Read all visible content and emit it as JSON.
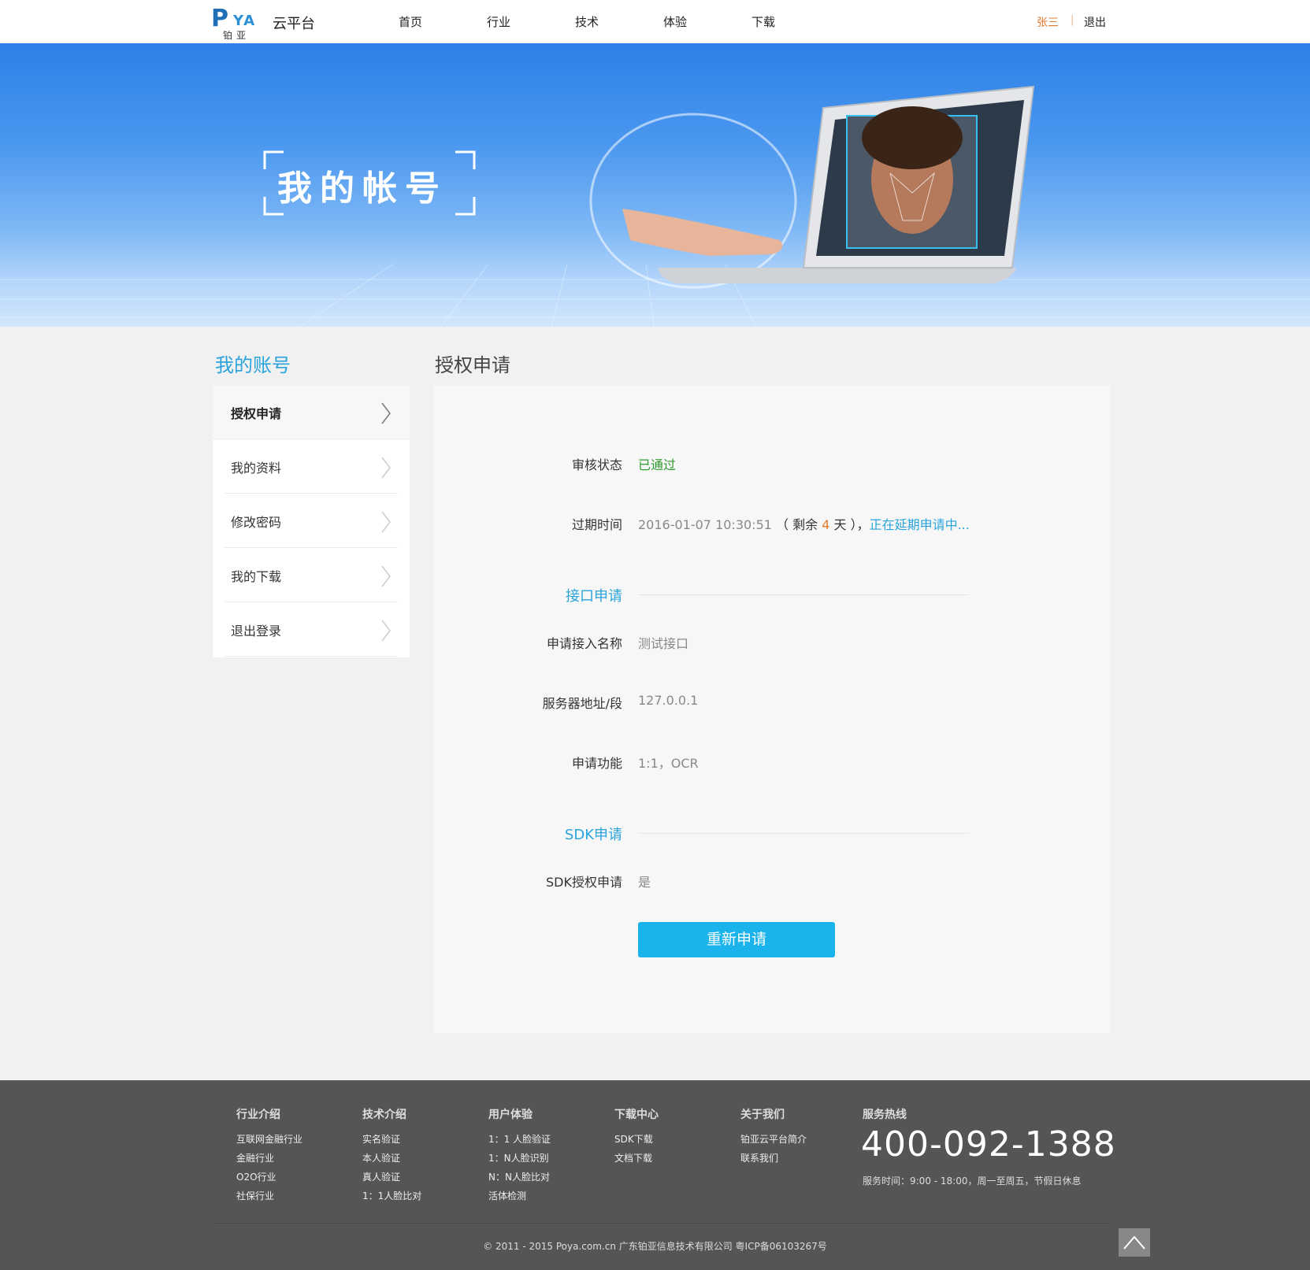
{
  "header": {
    "logo_letter": "P",
    "logo_ya": "YA",
    "logo_cn": "铂亚",
    "brand": "云平台",
    "nav": [
      "首页",
      "行业",
      "技术",
      "体验",
      "下载"
    ],
    "user": "张三",
    "separator": "|",
    "logout": "退出"
  },
  "banner": {
    "title": "我的帐号"
  },
  "sidebar": {
    "title": "我的账号",
    "items": [
      {
        "label": "授权申请",
        "active": true
      },
      {
        "label": "我的资料"
      },
      {
        "label": "修改密码"
      },
      {
        "label": "我的下载"
      },
      {
        "label": "退出登录"
      }
    ]
  },
  "main": {
    "title": "授权申请",
    "status_label": "审核状态",
    "status_value": "已通过",
    "expire_label": "过期时间",
    "expire_date": "2016-01-07 10:30:51",
    "remain_prefix": "（ 剩余",
    "remain_days": "4",
    "remain_suffix": "天 ），",
    "extend_link": "正在延期申请中...",
    "api_section": "接口申请",
    "api_name_label": "申请接入名称",
    "api_name_value": "测试接口",
    "server_label": "服务器地址/段",
    "server_value": "127.0.0.1",
    "func_label": "申请功能",
    "func_value": "1:1，OCR",
    "sdk_section": "SDK申请",
    "sdk_label": "SDK授权申请",
    "sdk_value": "是",
    "reapply_button": "重新申请"
  },
  "footer": {
    "columns": [
      {
        "title": "行业介绍",
        "items": [
          "互联网金融行业",
          "金融行业",
          "O2O行业",
          "社保行业"
        ]
      },
      {
        "title": "技术介绍",
        "items": [
          "实名验证",
          "本人验证",
          "真人验证",
          "1：1人脸比对"
        ]
      },
      {
        "title": "用户体验",
        "items": [
          "1：1 人脸验证",
          "1：N人脸识别",
          "N：N人脸比对",
          "活体检测"
        ]
      },
      {
        "title": "下载中心",
        "items": [
          "SDK下载",
          "文档下载"
        ]
      },
      {
        "title": "关于我们",
        "items": [
          "铂亚云平台简介",
          "联系我们"
        ]
      }
    ],
    "hotline_title": "服务热线",
    "hotline": "400-092-1388",
    "service_time": "服务时间：9:00 - 18:00，周一至周五，节假日休息",
    "copyright": "© 2011 - 2015 Poya.com.cn 广东铂亚信息技术有限公司 粤ICP备06103267号"
  },
  "colors": {
    "accent": "#2aa3dc",
    "button": "#1ab3ec",
    "passed": "#2e9b2e",
    "highlight": "#e27a2d",
    "footer_bg": "#555555"
  },
  "icons": [
    "chevron-right-icon",
    "arrow-up-icon"
  ]
}
